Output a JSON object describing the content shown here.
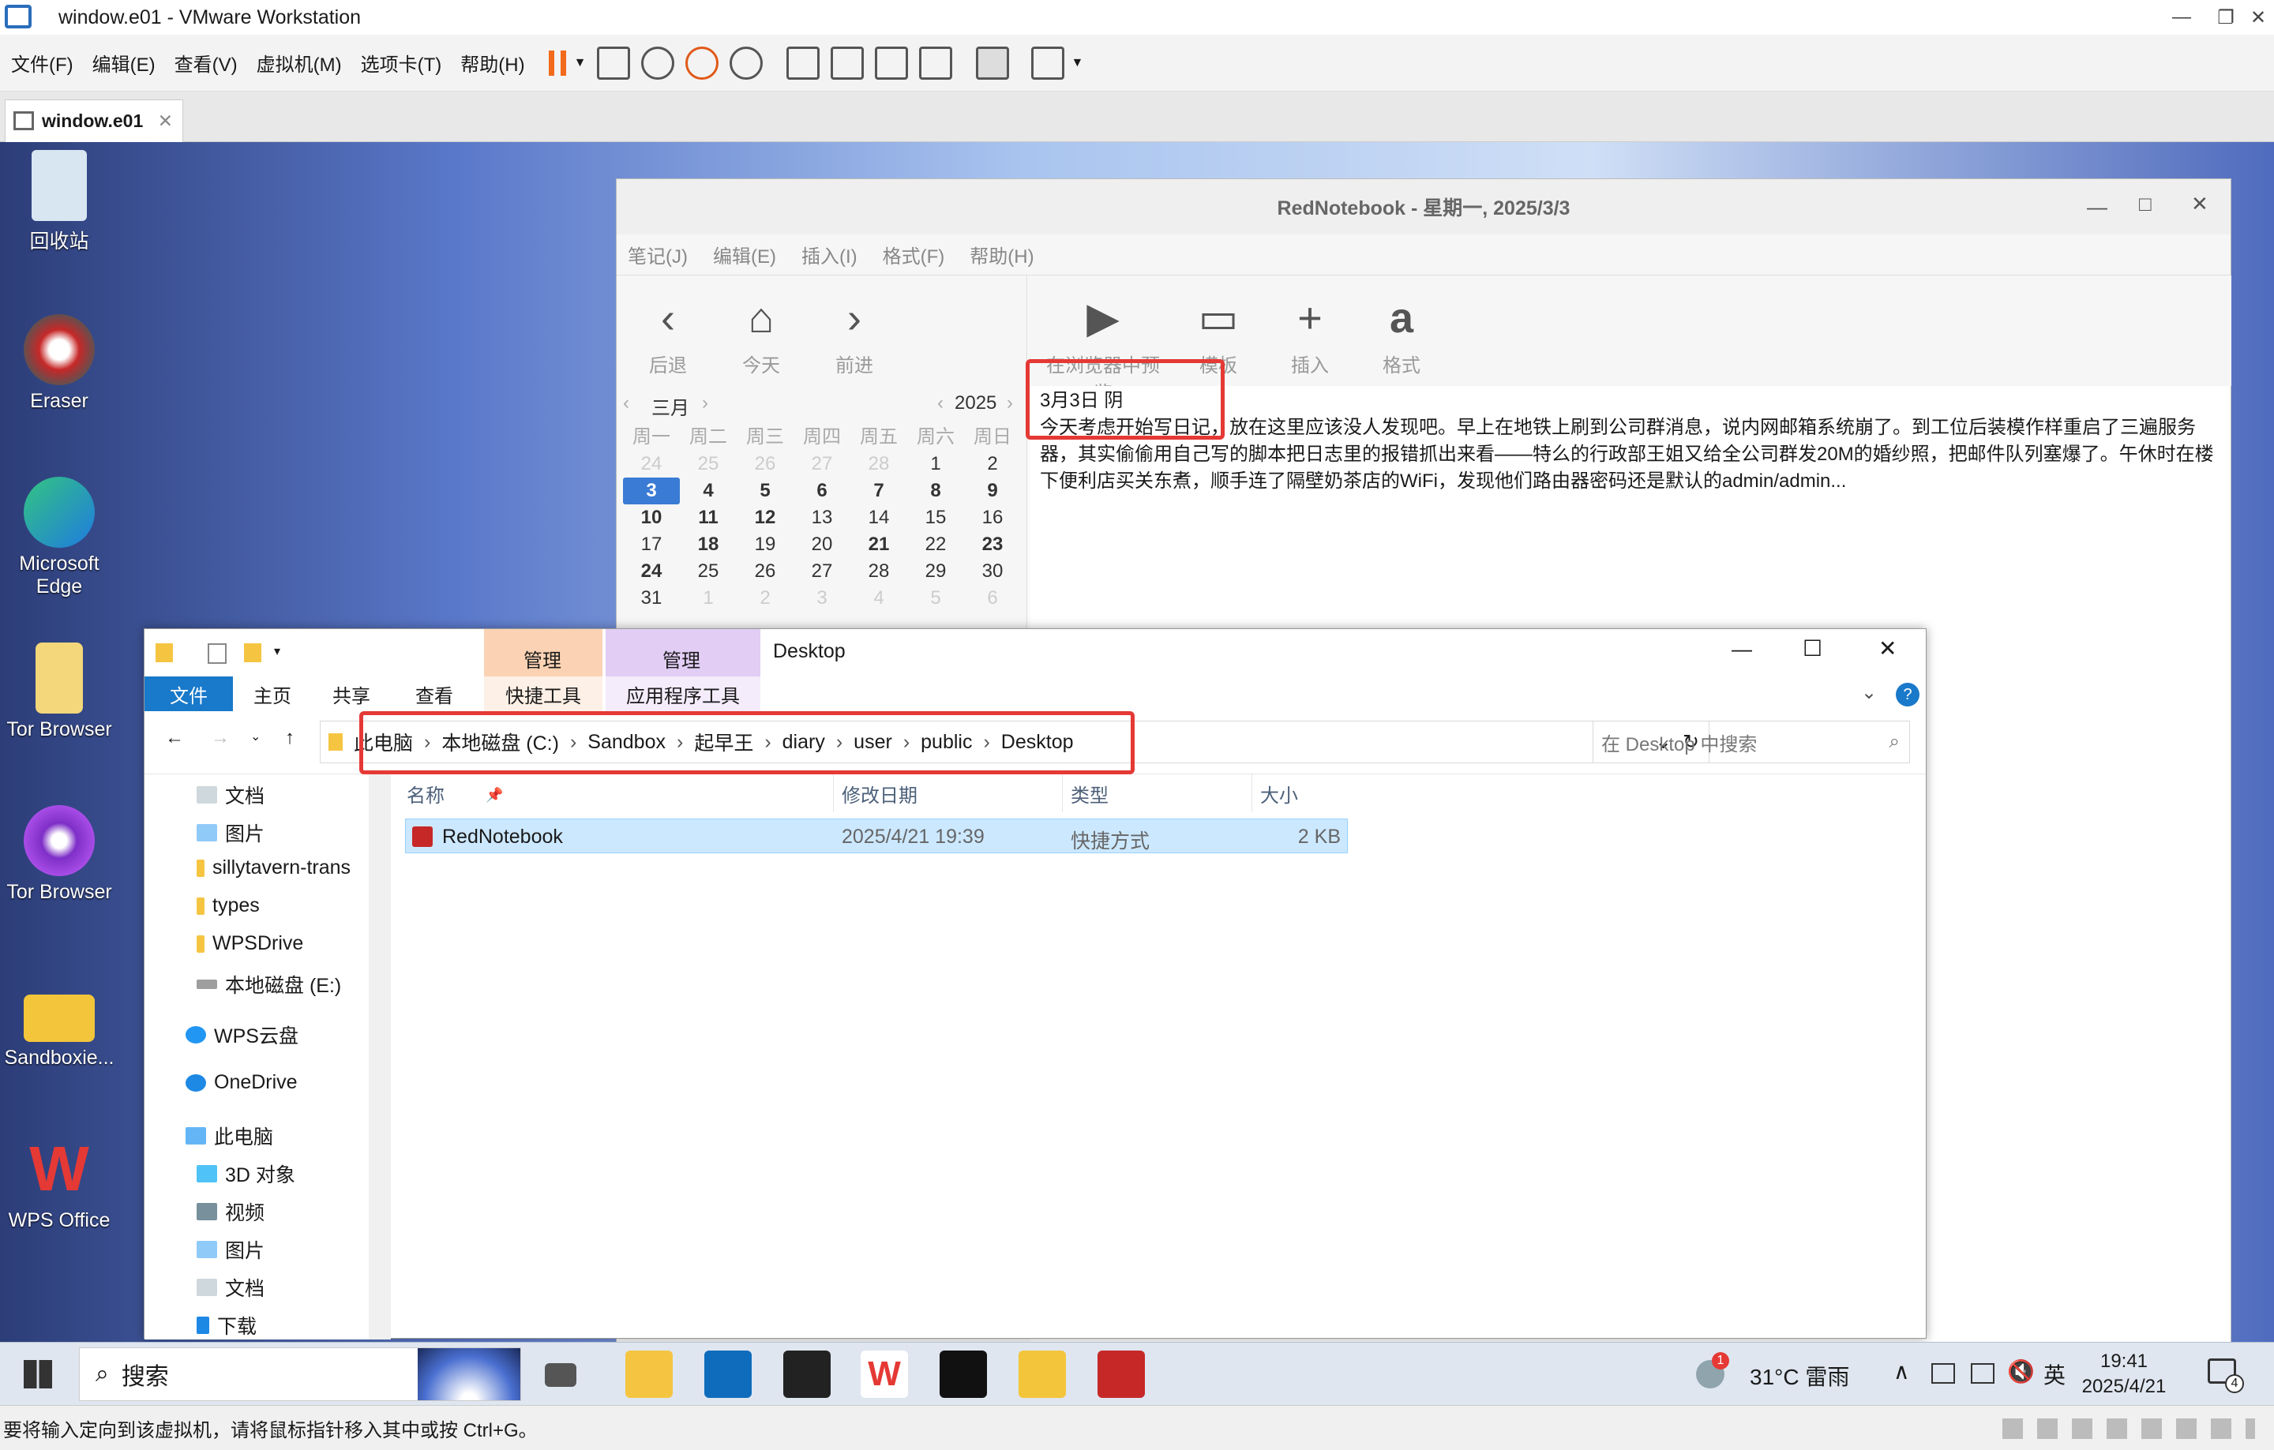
{
  "vmware": {
    "title": "window.e01 - VMware Workstation",
    "menu": [
      "文件(F)",
      "编辑(E)",
      "查看(V)",
      "虚拟机(M)",
      "选项卡(T)",
      "帮助(H)"
    ],
    "tab_label": "window.e01",
    "status_text": "要将输入定向到该虚拟机，请将鼠标指针移入其中或按 Ctrl+G。"
  },
  "desktop_icons": [
    "回收站",
    "Eraser",
    "Microsoft Edge",
    "Tor Browser",
    "Tor Browser",
    "Sandboxie...",
    "WPS Office"
  ],
  "rednotebook": {
    "title": "RedNotebook - 星期一, 2025/3/3",
    "menu": [
      "笔记(J)",
      "编辑(E)",
      "插入(I)",
      "格式(F)",
      "帮助(H)"
    ],
    "nav_buttons": [
      "后退",
      "今天",
      "前进"
    ],
    "tool_buttons": [
      "在浏览器中预览",
      "模板",
      "插入",
      "格式"
    ],
    "calendar": {
      "month": "三月",
      "year": "2025",
      "weekdays": [
        "周一",
        "周二",
        "周三",
        "周四",
        "周五",
        "周六",
        "周日"
      ],
      "days": [
        "24",
        "25",
        "26",
        "27",
        "28",
        "1",
        "2",
        "3",
        "4",
        "5",
        "6",
        "7",
        "8",
        "9",
        "10",
        "11",
        "12",
        "13",
        "14",
        "15",
        "16",
        "17",
        "18",
        "19",
        "20",
        "21",
        "22",
        "23",
        "24",
        "25",
        "26",
        "27",
        "28",
        "29",
        "30",
        "31",
        "1",
        "2",
        "3",
        "4",
        "5",
        "6"
      ]
    },
    "entry_heading": "3月3日 阴",
    "entry_line1": "今天考虑开始写日记，放在这里应该没人发现吧。早上在地铁上刷到公司群消息，说内网邮箱系统崩了。到工位后装模作样重启了三遍服务",
    "entry_line2": "器，其实偷偷用自己写的脚本把日志里的报错抓出来看——特么的行政部王姐又给全公司群发20M的婚纱照，把邮件队列塞爆了。午休时在楼",
    "entry_line3": "下便利店买关东煮，顺手连了隔壁奶茶店的WiFi，发现他们路由器密码还是默认的admin/admin..."
  },
  "explorer": {
    "title": "Desktop",
    "ribbon_tabs": [
      "文件",
      "主页",
      "共享",
      "查看",
      "快捷工具",
      "应用程序工具"
    ],
    "context_labels": [
      "管理",
      "管理"
    ],
    "breadcrumb": [
      "此电脑",
      "本地磁盘 (C:)",
      "Sandbox",
      "起早王",
      "diary",
      "user",
      "public",
      "Desktop"
    ],
    "search_placeholder": "在 Desktop 中搜索",
    "nav_items": [
      "文档",
      "图片",
      "sillytavern-trans",
      "types",
      "WPSDrive",
      "本地磁盘 (E:)",
      "WPS云盘",
      "OneDrive",
      "此电脑",
      "3D 对象",
      "视频",
      "图片",
      "文档",
      "下载"
    ],
    "columns": [
      "名称",
      "修改日期",
      "类型",
      "大小"
    ],
    "rows": [
      {
        "name": "RedNotebook",
        "date": "2025/4/21 19:39",
        "type": "快捷方式",
        "size": "2 KB"
      }
    ]
  },
  "taskbar": {
    "search_label": "搜索",
    "weather": "31°C 雷雨",
    "ime": "英",
    "time": "19:41",
    "date": "2025/4/21",
    "notification_count": "4",
    "weather_badge": "1"
  }
}
